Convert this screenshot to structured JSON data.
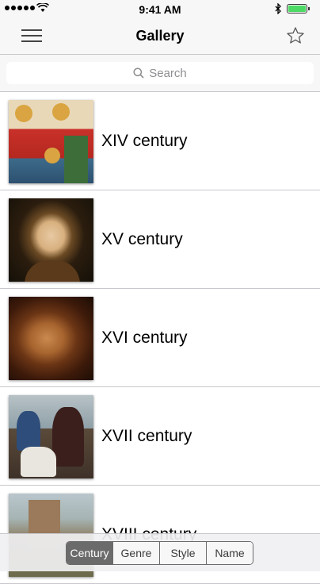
{
  "status_bar": {
    "time": "9:41 AM"
  },
  "nav": {
    "title": "Gallery",
    "menu_icon": "hamburger-menu-icon",
    "favorite_icon": "star-outline-icon"
  },
  "search": {
    "placeholder": "Search"
  },
  "centuries": [
    {
      "label": "XIV century"
    },
    {
      "label": "XV century"
    },
    {
      "label": "XVI century"
    },
    {
      "label": "XVII century"
    },
    {
      "label": "XVIII century"
    }
  ],
  "segments": {
    "selected": "Century",
    "items": [
      {
        "label": "Century"
      },
      {
        "label": "Genre"
      },
      {
        "label": "Style"
      },
      {
        "label": "Name"
      }
    ]
  },
  "colors": {
    "accent": "#6b6b6b",
    "battery": "#4cd964",
    "separator": "#c8c7cc"
  }
}
